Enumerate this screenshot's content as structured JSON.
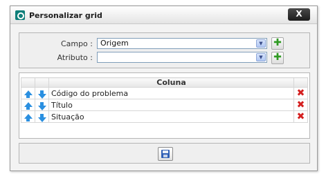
{
  "dialog": {
    "title": "Personalizar grid",
    "close_label": "X"
  },
  "form": {
    "campo_label": "Campo :",
    "campo_value": "Origem",
    "atributo_label": "Atributo :",
    "atributo_value": ""
  },
  "grid": {
    "header": "Coluna",
    "rows": [
      {
        "label": "Código do problema"
      },
      {
        "label": "Título"
      },
      {
        "label": "Situação"
      }
    ]
  },
  "icons": {
    "app": "app-logo-icon",
    "add": "plus-icon",
    "up": "arrow-up-icon",
    "down": "arrow-down-icon",
    "delete": "red-x-icon",
    "save": "floppy-disk-icon"
  },
  "colors": {
    "accent": "#0f7f7a",
    "arrow": "#2a8fe0",
    "delete": "#d42020",
    "add": "#2f9a23"
  }
}
